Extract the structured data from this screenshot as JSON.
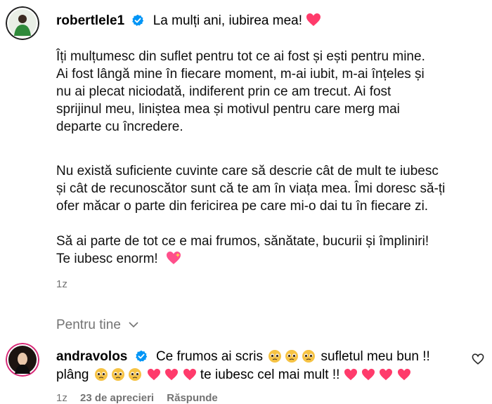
{
  "post": {
    "username": "robertlele1",
    "caption_title": "La mulți ani, iubirea mea!",
    "paragraph1": [
      "Îți mulțumesc din suflet pentru tot ce ai fost și ești pentru mine.",
      "Ai fost lângă mine în fiecare moment, m-ai iubit, m-ai înțeles și",
      "nu ai plecat niciodată, indiferent prin ce am trecut. Ai fost",
      "sprijinul meu, liniștea mea și motivul pentru care merg mai",
      "departe cu încredere."
    ],
    "paragraph2": [
      "Nu există suficiente cuvinte care să descrie cât de mult te iubesc",
      "și cât de recunoscător sunt că te am în viața mea. Îmi doresc să-ți",
      "ofer măcar o parte din fericirea pe care mi-o dai tu în fiecare zi."
    ],
    "paragraph3_line1": "Să ai parte de tot ce e mai frumos, sănătate, bucurii și împliniri!",
    "paragraph3_line2": "Te iubesc enorm!",
    "time": "1z"
  },
  "section_label": "Pentru tine",
  "comment": {
    "username": "andravolos",
    "text_part1": "Ce frumos ai scris",
    "text_part2": "sufletul meu bun !!",
    "text_part3": "plâng",
    "text_part4": "te iubesc cel mai mult !!",
    "time": "1z",
    "likes": "23 de aprecieri",
    "reply": "Răspunde"
  },
  "colors": {
    "verified": "#0095f6",
    "heart": "#ff3b6b",
    "muted": "#737373"
  },
  "icons": {
    "verified": "verified-badge-icon",
    "heart": "red-heart-icon",
    "sparkling_heart": "sparkling-heart-icon",
    "crying_face": "pleading-face-icon",
    "like": "heart-outline-icon",
    "chevron": "chevron-down-icon"
  }
}
